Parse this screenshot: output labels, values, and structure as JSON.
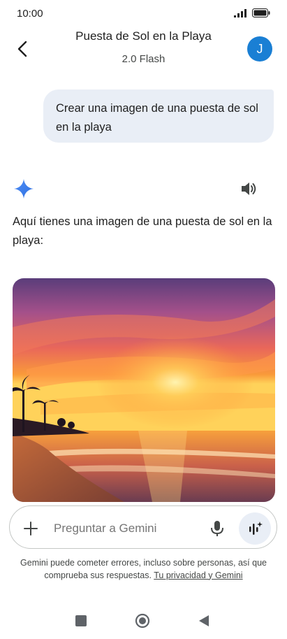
{
  "status_bar": {
    "time": "10:00"
  },
  "header": {
    "title": "Puesta de Sol en la Playa",
    "subtitle": "2.0 Flash",
    "avatar_initial": "J",
    "avatar_color": "#1a7fd4"
  },
  "user_message": "Crear una imagen de una puesta de sol en la playa",
  "response": {
    "text": "Aquí tienes una imagen de una puesta de sol en la playa:"
  },
  "input": {
    "placeholder": "Preguntar a Gemini"
  },
  "disclaimer": {
    "text": "Gemini puede cometer errores, incluso sobre personas, así que comprueba sus respuestas.",
    "link": "Tu privacidad y Gemini"
  },
  "icons": [
    "back-arrow-icon",
    "gemini-sparkle-icon",
    "speaker-icon",
    "plus-icon",
    "mic-icon",
    "live-waveform-icon",
    "signal-icon",
    "battery-icon"
  ],
  "colors": {
    "bubble_bg": "#e9eef6",
    "accent": "#4285f4",
    "text": "#1f1f1f"
  }
}
